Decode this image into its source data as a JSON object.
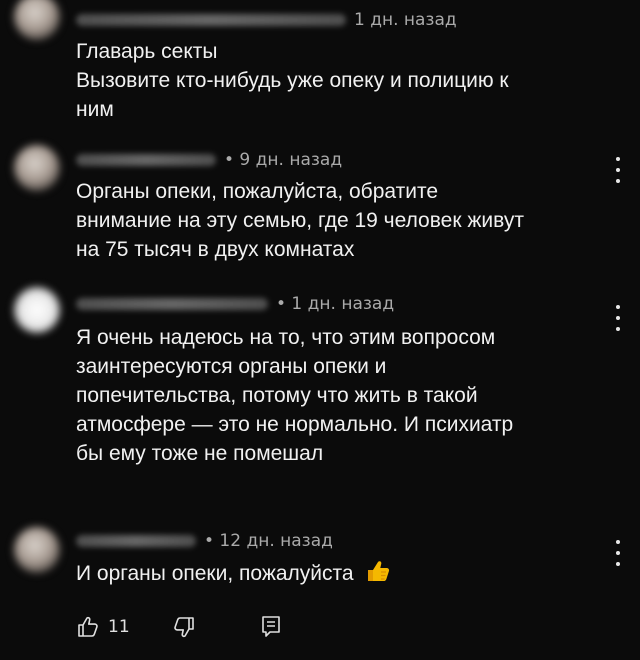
{
  "comments": [
    {
      "time": "1 дн. назад",
      "lines": [
        "Главарь секты",
        "Вызовите кто-нибудь уже опеку и полицию к",
        "ним"
      ]
    },
    {
      "time": "• 9 дн. назад",
      "lines": [
        "Органы опеки, пожалуйста, обратите",
        "внимание на эту семью, где 19 человек живут",
        "на 75 тысяч в двух комнатах"
      ]
    },
    {
      "time": "• 1 дн. назад",
      "lines": [
        "Я очень надеюсь на то, что этим вопросом",
        "заинтересуются органы опеки и",
        "попечительства, потому что жить в такой",
        "атмосфере — это не нормально. И психиатр",
        "бы ему тоже не помешал"
      ]
    },
    {
      "time": "• 12 дн. назад",
      "lines": [
        "И органы опеки, пожалуйста"
      ],
      "emoji": "thumbs-up-emoji",
      "like_count": "11"
    }
  ],
  "icons": {
    "like": "thumbs-up-outline-icon",
    "dislike": "thumbs-down-outline-icon",
    "reply": "reply-comment-icon",
    "more": "more-vertical-icon"
  },
  "colors": {
    "background": "#0b0b0b",
    "text": "#f1f1f1",
    "meta": "#aaaaaa",
    "emoji": "#f5b800"
  }
}
